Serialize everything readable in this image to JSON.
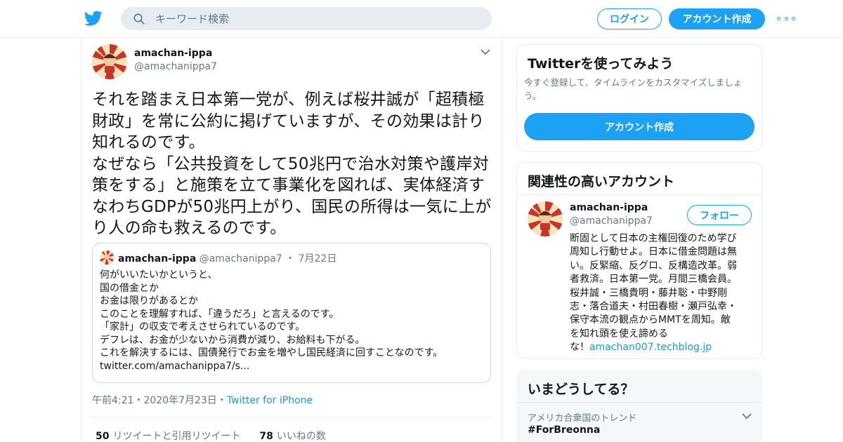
{
  "header": {
    "search_placeholder": "キーワード検索",
    "login_label": "ログイン",
    "signup_label": "アカウント作成",
    "brand_color": "#1da1f2"
  },
  "tweet": {
    "author_name": "amachan-ippa",
    "author_handle": "@amachanippa7",
    "text_lines": [
      "それを踏まえ日本第一党が、例えば桜井誠が「超積極",
      "財政」を常に公約に掲げていますが、その効果は計り",
      "知れるのです。",
      "なぜなら「公共投資をして50兆円で治水対策や護岸対",
      "策をする」と施策を立て事業化を図れば、実体経済す",
      "なわちGDPが50兆円上がり、国民の所得は一気に上が",
      "り人の命も救えるのです。"
    ],
    "quoted": {
      "author_name": "amachan-ippa",
      "author_handle": "@amachanippa7",
      "separator": "・",
      "date": "7月22日",
      "text_lines": [
        "何がいいたいかというと、",
        "国の借金とか",
        "お金は限りがあるとか",
        "このことを理解すれば、「違うだろ」と言えるのです。",
        "「家計」の収支で考えさせられているのです。",
        "デフレは、お金が少ないから消費が減り、お給料も下がる。",
        "これを解決するには、国債発行でお金を増やし国民経済に回すことなのです。",
        "twitter.com/amachanippa7/s..."
      ]
    },
    "time": "午前4:21",
    "separator": "・",
    "date": "2020年7月23日",
    "source": "Twitter for iPhone",
    "retweets_count": "50",
    "retweets_label": "リツイートと引用リツイート",
    "likes_count": "78",
    "likes_label": "いいねの数"
  },
  "sidebar": {
    "signup_card": {
      "title": "Twitterを使ってみよう",
      "description": "今すぐ登録して、タイムラインをカスタマイズしましょう。",
      "button_label": "アカウント作成"
    },
    "related_card": {
      "title": "関連性の高いアカウント",
      "account_name": "amachan-ippa",
      "account_handle": "@amachanippa7",
      "follow_label": "フォロー",
      "bio_lines": [
        "断固として日本の主権回復のため学び",
        "周知し行動せよ。日本に借金問題は無",
        "い。反緊縮、反グロ、反構造改革。弱",
        "者救済。日本第一党。月間三橋会員。",
        "桜井誠・三橋貴明・藤井聡・中野剛",
        "志・落合道夫・村田春樹・瀬戸弘幸・",
        "保守本流の観点からMMTを周知。敵",
        "を知れ頭を使え諦める"
      ],
      "bio_last_prefix": "な！",
      "bio_link": "amachan007.techblog.jp"
    },
    "trends_card": {
      "title": "いまどうしてる？",
      "trend_label": "アメリカ合衆国のトレンド",
      "trend_tag": "#ForBreonna"
    }
  },
  "icons": {
    "logo": "twitter-bird-icon",
    "search": "search-icon",
    "more": "more-dots-icon",
    "chevron": "chevron-down-icon"
  }
}
